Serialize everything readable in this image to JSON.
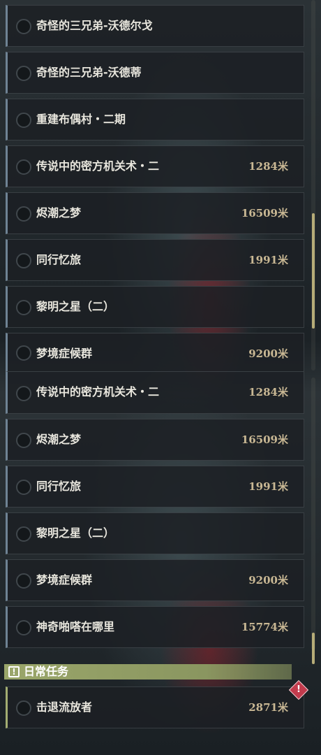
{
  "quest_list_top": [
    {
      "name": "奇怪的三兄弟-沃德尔戈",
      "distance": ""
    },
    {
      "name": "奇怪的三兄弟-沃德蒂",
      "distance": ""
    },
    {
      "name": "重建布偶村・二期",
      "distance": ""
    },
    {
      "name": "传说中的密方机关术・二",
      "distance": "1284米"
    },
    {
      "name": "烬潮之梦",
      "distance": "16509米"
    },
    {
      "name": "同行忆旅",
      "distance": "1991米"
    },
    {
      "name": "黎明之星（二）",
      "distance": ""
    },
    {
      "name": "梦境症候群",
      "distance": "9200米"
    }
  ],
  "quest_list_bottom": [
    {
      "name": "传说中的密方机关术・二",
      "distance": "1284米"
    },
    {
      "name": "烬潮之梦",
      "distance": "16509米"
    },
    {
      "name": "同行忆旅",
      "distance": "1991米"
    },
    {
      "name": "黎明之星（二）",
      "distance": ""
    },
    {
      "name": "梦境症候群",
      "distance": "9200米"
    },
    {
      "name": "神奇啪嗒在哪里",
      "distance": "15774米"
    }
  ],
  "daily_section": {
    "icon": "exclamation-box-icon",
    "icon_glyph": "!",
    "title": "日常任务",
    "quests": [
      {
        "name": "击退流放者",
        "distance": "2871米"
      }
    ],
    "alert_icon": "alert-diamond-icon",
    "alert_glyph": "!"
  },
  "colors": {
    "daily_accent": "#9aa66a",
    "distance_text": "#c9b894",
    "alert": "#c23b4d"
  }
}
